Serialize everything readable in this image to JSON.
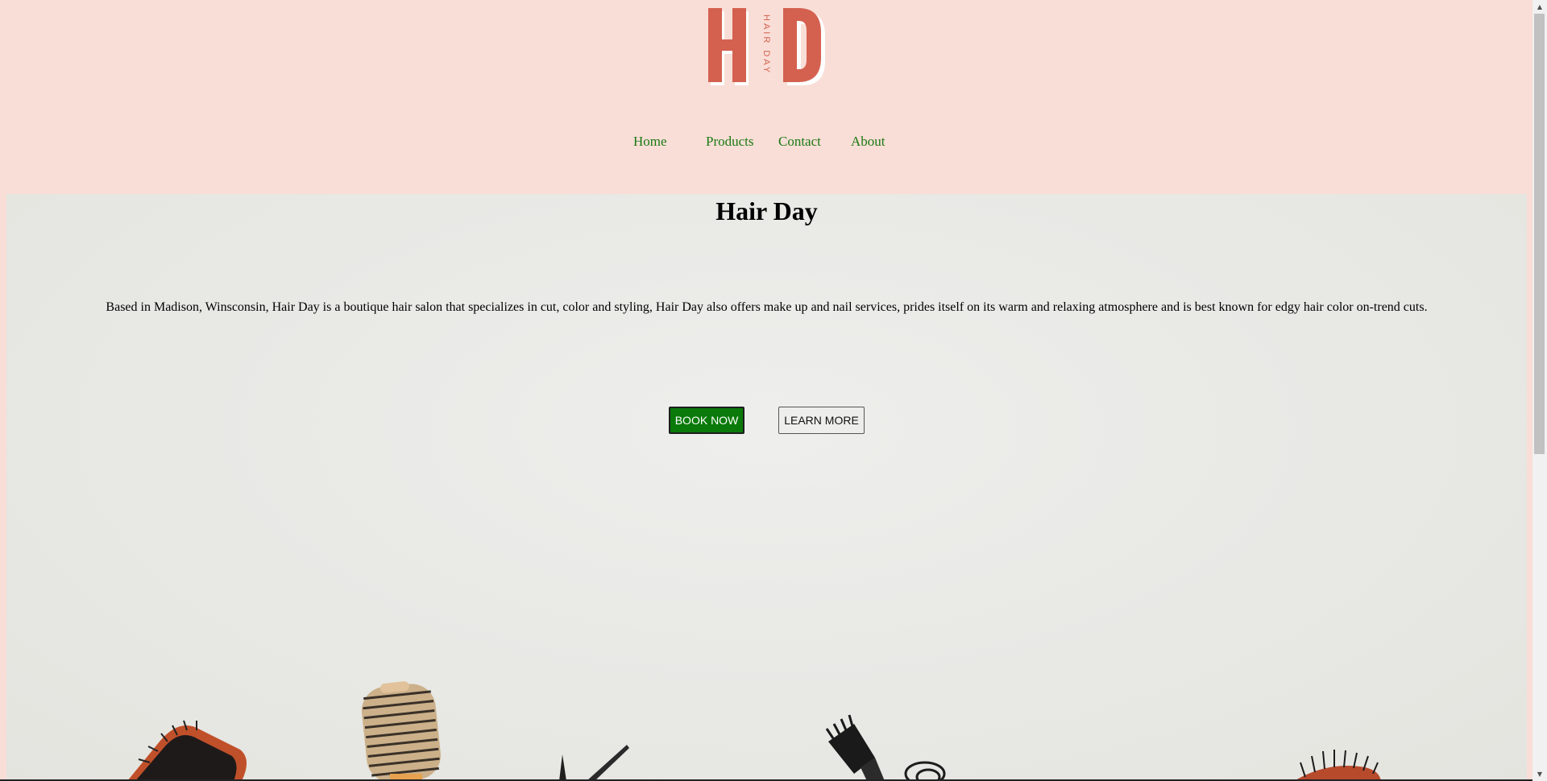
{
  "brand": {
    "logo_letters": "HD",
    "logo_tagline": "HAIR DAY",
    "logo_color": "#d4614f"
  },
  "nav": {
    "items": [
      {
        "label": "Home"
      },
      {
        "label": "Products"
      },
      {
        "label": "Contact"
      },
      {
        "label": "About"
      }
    ],
    "link_color": "#1a7a12"
  },
  "hero": {
    "title": "Hair Day",
    "description": "Based in Madison, Winsconsin, Hair Day is a boutique hair salon that specializes in cut, color and styling, Hair Day also offers make up and nail services, prides itself on its warm and relaxing atmosphere and is best known for edgy hair color on-trend cuts.",
    "buttons": {
      "book_label": "BOOK NOW",
      "learn_label": "LEARN MORE"
    },
    "book_color": "#0a7a0a"
  },
  "colors": {
    "page_background": "#f9ded7",
    "hero_background": "#e9e9e6"
  },
  "icons": [
    "paddle-brush-icon",
    "round-brush-icon",
    "scissors-icon",
    "tint-brush-icon",
    "hair-clip-icon",
    "bristle-brush-icon"
  ]
}
